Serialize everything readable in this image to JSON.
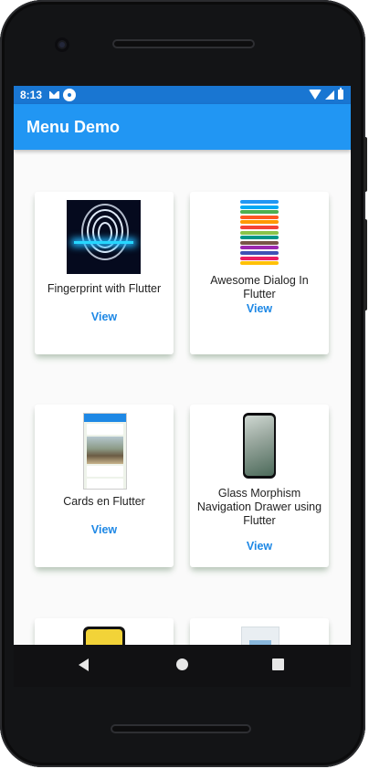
{
  "statusbar": {
    "time": "8:13"
  },
  "appbar": {
    "title": "Menu Demo"
  },
  "cards": [
    {
      "label": "Fingerprint with Flutter",
      "action": "View",
      "thumb_icon": "fingerprint-image"
    },
    {
      "label": "Awesome Dialog In Flutter",
      "action": "View",
      "thumb_icon": "dialog-buttons-image"
    },
    {
      "label": "Cards en Flutter",
      "action": "View",
      "thumb_icon": "cards-app-image"
    },
    {
      "label": "Glass Morphism Navigation Drawer using Flutter",
      "action": "View",
      "thumb_icon": "glass-drawer-phone-image"
    },
    {
      "label": "",
      "action": "",
      "thumb_icon": "yellow-phone-image"
    },
    {
      "label": "",
      "action": "",
      "thumb_icon": "blue-screenshot-image"
    }
  ],
  "colors": {
    "appbar": "#2196f3",
    "statusbar": "#1976d2",
    "link": "#1e88e5",
    "dialog_bars": [
      "#2196f3",
      "#03a9f4",
      "#4caf50",
      "#ff5722",
      "#ff9800",
      "#f44336",
      "#8bc34a",
      "#009688",
      "#795548",
      "#9c27b0",
      "#3f51b5",
      "#e91e63",
      "#ffc107"
    ]
  },
  "navbar": {
    "back_icon": "triangle-back-icon",
    "home_icon": "circle-home-icon",
    "recent_icon": "square-recents-icon"
  }
}
